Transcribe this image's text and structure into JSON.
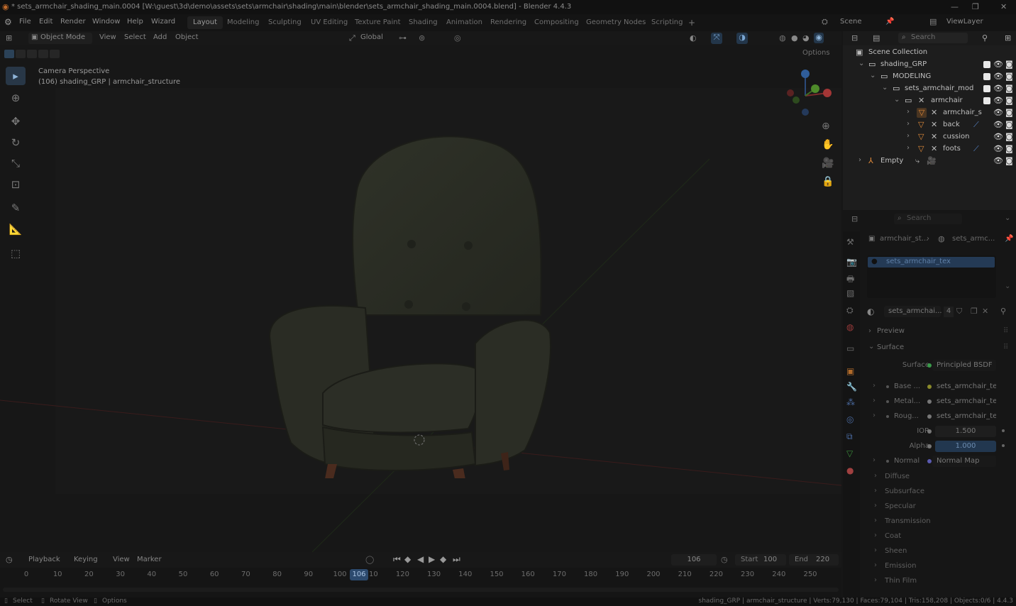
{
  "window": {
    "title": "* sets_armchair_shading_main.0004 [W:\\guest\\3d\\demo\\assets\\sets\\armchair\\shading\\main\\blender\\sets_armchair_shading_main.0004.blend] - Blender 4.4.3"
  },
  "menu": {
    "items": [
      "File",
      "Edit",
      "Render",
      "Window",
      "Help",
      "Wizard"
    ],
    "workspaces": [
      "Layout",
      "Modeling",
      "Sculpting",
      "UV Editing",
      "Texture Paint",
      "Shading",
      "Animation",
      "Rendering",
      "Compositing",
      "Geometry Nodes",
      "Scripting"
    ],
    "active_workspace": "Layout",
    "scene": "Scene",
    "view_layer": "ViewLayer"
  },
  "viewport_header": {
    "mode": "Object Mode",
    "menus": [
      "View",
      "Select",
      "Add",
      "Object"
    ],
    "transform_orientation": "Global",
    "options": "Options"
  },
  "viewport": {
    "overlay_line1": "Camera Perspective",
    "overlay_line2": "(106) shading_GRP | armchair_structure",
    "tools": [
      "select-box",
      "cursor",
      "move",
      "rotate",
      "scale",
      "transform",
      "annotate",
      "measure",
      "add-cube"
    ]
  },
  "outliner": {
    "search_placeholder": "Search",
    "root": "Scene Collection",
    "rows": [
      {
        "label": "shading_GRP"
      },
      {
        "label": "MODELING"
      },
      {
        "label": "sets_armchair_mod"
      },
      {
        "label": "armchair"
      },
      {
        "label": "armchair_s"
      },
      {
        "label": "back"
      },
      {
        "label": "cussion"
      },
      {
        "label": "foots"
      },
      {
        "label": "Empty"
      }
    ]
  },
  "properties": {
    "search_placeholder": "Search",
    "breadcrumb": [
      "armchair_st...",
      "sets_armc..."
    ],
    "material_slot": "sets_armchair_tex",
    "material_name": "sets_armchai...",
    "user_count": "4",
    "panels": {
      "preview": "Preview",
      "surface": "Surface"
    },
    "surface": {
      "surface_label": "Surface",
      "surface_value": "Principled BSDF",
      "base_label": "Base ...",
      "base_value": "sets_armchair_te...",
      "metal_label": "Metal...",
      "metal_value": "sets_armchair_te...",
      "rough_label": "Roug...",
      "rough_value": "sets_armchair_te...",
      "ior_label": "IOR",
      "ior_value": "1.500",
      "alpha_label": "Alpha",
      "alpha_value": "1.000",
      "normal_label": "Normal",
      "normal_value": "Normal Map"
    },
    "subpanels": [
      "Diffuse",
      "Subsurface",
      "Specular",
      "Transmission",
      "Coat",
      "Sheen",
      "Emission",
      "Thin Film"
    ]
  },
  "timeline": {
    "menus": [
      "Playback",
      "Keying",
      "View",
      "Marker"
    ],
    "current_frame": "106",
    "start_label": "Start",
    "start": "100",
    "end_label": "End",
    "end": "220",
    "ticks": [
      "0",
      "10",
      "20",
      "30",
      "40",
      "50",
      "60",
      "70",
      "80",
      "90",
      "100",
      "110",
      "120",
      "130",
      "140",
      "150",
      "160",
      "170",
      "180",
      "190",
      "200",
      "210",
      "220",
      "230",
      "240",
      "250"
    ]
  },
  "statusbar": {
    "left": [
      "Select",
      "Rotate View",
      "Options"
    ],
    "right": "shading_GRP | armchair_structure | Verts:79,130 | Faces:79,104 | Tris:158,208 | Objects:0/6 | 4.4.3"
  },
  "colors": {
    "accent": "#3d6fa8",
    "chair_fabric": "#2b2e24",
    "chair_legs": "#4a2b1e"
  }
}
